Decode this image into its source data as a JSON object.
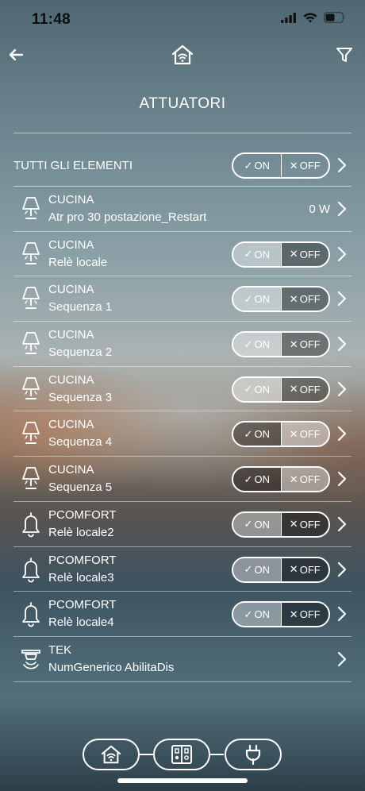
{
  "status": {
    "time": "11:48"
  },
  "page": {
    "title": "ATTUATORI"
  },
  "all_items": {
    "label": "TUTTI GLI ELEMENTI",
    "on": "ON",
    "off": "OFF"
  },
  "items": [
    {
      "room": "CUCINA",
      "name": "Atr pro 30 postazione_Restart",
      "icon": "lamp-icon",
      "value": "0 W"
    },
    {
      "room": "CUCINA",
      "name": "Relè locale",
      "icon": "lamp-icon",
      "on": "ON",
      "off": "OFF",
      "state": "on"
    },
    {
      "room": "CUCINA",
      "name": "Sequenza 1",
      "icon": "lamp-icon",
      "on": "ON",
      "off": "OFF",
      "state": "on"
    },
    {
      "room": "CUCINA",
      "name": "Sequenza 2",
      "icon": "lamp-icon",
      "on": "ON",
      "off": "OFF",
      "state": "on"
    },
    {
      "room": "CUCINA",
      "name": "Sequenza 3",
      "icon": "lamp-icon",
      "on": "ON",
      "off": "OFF",
      "state": "on"
    },
    {
      "room": "CUCINA",
      "name": "Sequenza 4",
      "icon": "lamp-icon",
      "on": "ON",
      "off": "OFF",
      "state": "off"
    },
    {
      "room": "CUCINA",
      "name": "Sequenza 5",
      "icon": "lamp-icon",
      "on": "ON",
      "off": "OFF",
      "state": "off"
    },
    {
      "room": "PCOMFORT",
      "name": "Relè locale2",
      "icon": "bell-icon",
      "on": "ON",
      "off": "OFF",
      "state": "on"
    },
    {
      "room": "PCOMFORT",
      "name": "Relè locale3",
      "icon": "bell-icon",
      "on": "ON",
      "off": "OFF",
      "state": "on"
    },
    {
      "room": "PCOMFORT",
      "name": "Relè locale4",
      "icon": "bell-icon",
      "on": "ON",
      "off": "OFF",
      "state": "on"
    },
    {
      "room": "TEK",
      "name": "NumGenerico AbilitaDis",
      "icon": "siren-icon"
    }
  ]
}
